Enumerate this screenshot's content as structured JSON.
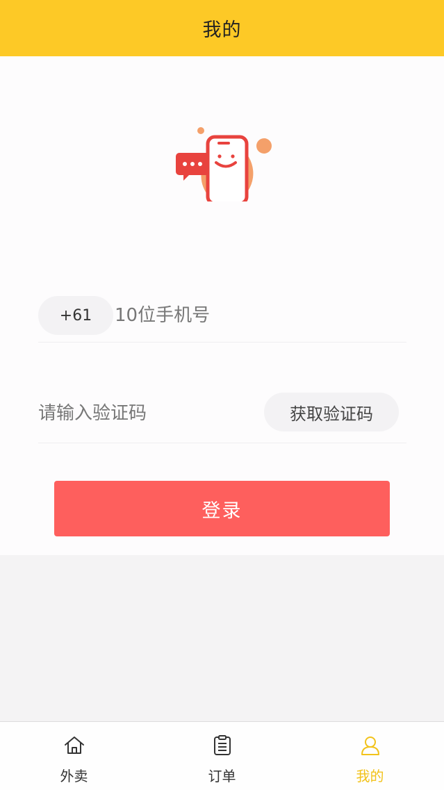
{
  "colors": {
    "header_bg": "#fdc926",
    "primary_button": "#fe5f5d",
    "tab_active": "#f2c21a",
    "tab_inactive": "#333333",
    "illustration_red": "#e8433e",
    "illustration_orange": "#f4a06a"
  },
  "header": {
    "title": "我的"
  },
  "login": {
    "illustration_icon": "phone-chat-illustration",
    "country_code": "+61",
    "phone_placeholder": "10位手机号",
    "code_placeholder": "请输入验证码",
    "get_code_label": "获取验证码",
    "login_label": "登录"
  },
  "tabbar": {
    "items": [
      {
        "label": "外卖",
        "icon": "home-icon",
        "active": false
      },
      {
        "label": "订单",
        "icon": "clipboard-icon",
        "active": false
      },
      {
        "label": "我的",
        "icon": "user-icon",
        "active": true
      }
    ]
  }
}
